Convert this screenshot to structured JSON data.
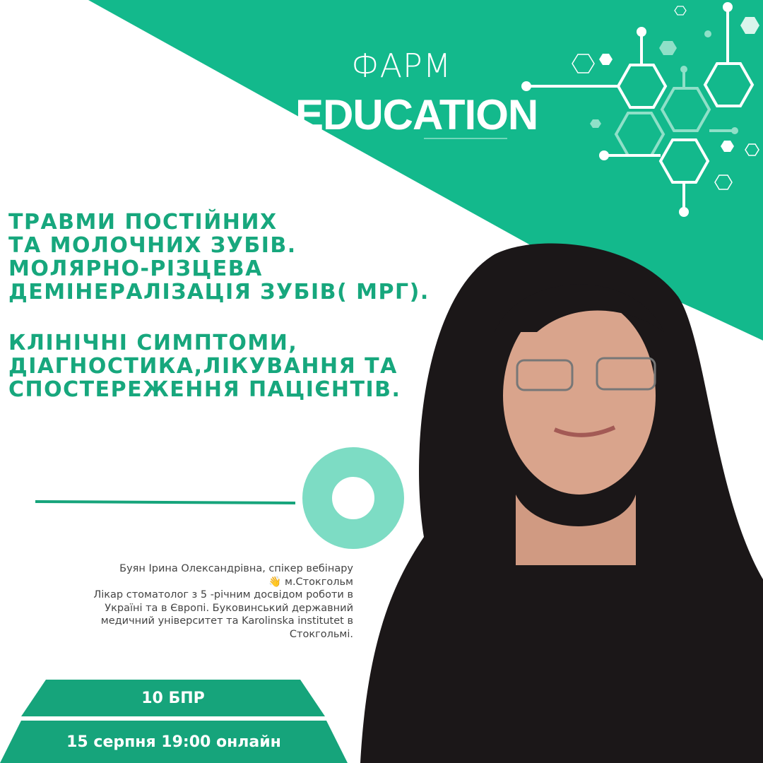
{
  "logo": {
    "line1": "ФАРМ",
    "line2": "EDUCATION"
  },
  "title": {
    "lines": [
      "ТРАВМИ ПОСТІЙНИХ",
      "ТА МОЛОЧНИХ ЗУБІВ.",
      "МОЛЯРНО-РІЗЦЕВА",
      "ДЕМІНЕРАЛІЗАЦІЯ ЗУБІВ( МРГ)."
    ],
    "lines2": [
      "КЛІНІЧНІ СИМПТОМИ,",
      "ДІАГНОСТИКА,ЛІКУВАННЯ ТА",
      "СПОСТЕРЕЖЕННЯ ПАЦІЄНТІВ."
    ]
  },
  "speaker": {
    "lines": [
      "Буян Ірина Олександрівна, спікер вебінару",
      "👋 м.Стокгольм",
      "Лікар стоматолог з 5 -річним досвідом роботи в",
      "Україні та в Європі. Буковинський державний",
      "медичний університет та Karolinska institutet в",
      "Стокгольмі."
    ]
  },
  "badge": {
    "points": "10 БПР",
    "date": "15 серпня  19:00  онлайн"
  },
  "colors": {
    "brand": "#13b98c",
    "title": "#17a77d",
    "ring": "#7ddcc4",
    "bar": "#16a47b"
  }
}
